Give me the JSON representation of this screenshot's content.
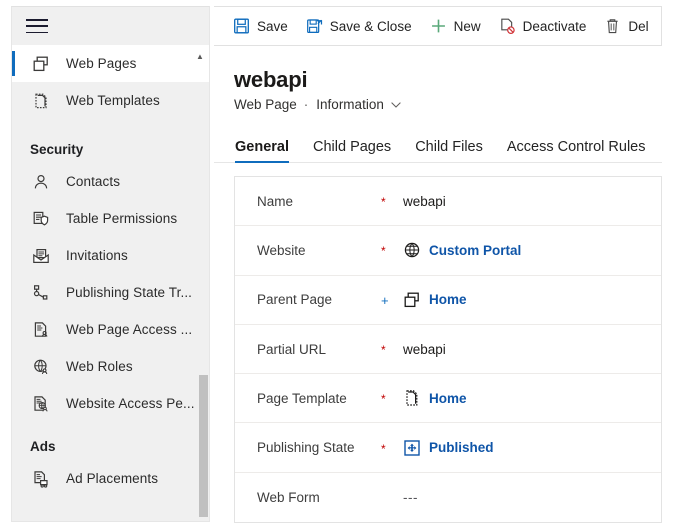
{
  "sidebar": {
    "menu_icon": "hamburger-icon",
    "scroll_up_icon": "scroll-up-arrow",
    "items": [
      {
        "type": "item",
        "label": "Web Pages",
        "icon": "web-pages-icon",
        "selected": true
      },
      {
        "type": "item",
        "label": "Web Templates",
        "icon": "web-templates-icon",
        "selected": false
      },
      {
        "type": "group",
        "label": "Security"
      },
      {
        "type": "item",
        "label": "Contacts",
        "icon": "contact-person-icon",
        "selected": false
      },
      {
        "type": "item",
        "label": "Table  Permissions",
        "icon": "table-permissions-icon",
        "selected": false
      },
      {
        "type": "item",
        "label": "Invitations",
        "icon": "invitations-envelope-icon",
        "selected": false
      },
      {
        "type": "item",
        "label": "Publishing State Tr...",
        "icon": "publishing-state-transition-icon",
        "selected": false
      },
      {
        "type": "item",
        "label": "Web Page Access ...",
        "icon": "web-page-access-icon",
        "selected": false
      },
      {
        "type": "item",
        "label": "Web Roles",
        "icon": "web-roles-globe-icon",
        "selected": false
      },
      {
        "type": "item",
        "label": "Website Access Pe...",
        "icon": "website-access-icon",
        "selected": false
      },
      {
        "type": "group",
        "label": "Ads"
      },
      {
        "type": "item",
        "label": "Ad Placements",
        "icon": "ad-placements-icon",
        "selected": false
      }
    ]
  },
  "commandbar": {
    "commands": [
      {
        "label": "Save",
        "icon": "save-icon"
      },
      {
        "label": "Save & Close",
        "icon": "save-and-close-icon"
      },
      {
        "label": "New",
        "icon": "plus-icon"
      },
      {
        "label": "Deactivate",
        "icon": "deactivate-icon"
      },
      {
        "label": "Del",
        "icon": "delete-trash-icon"
      }
    ]
  },
  "header": {
    "title": "webapi",
    "entity": "Web Page",
    "separator": "·",
    "form_name": "Information",
    "chevron": "⌄"
  },
  "tabs": [
    {
      "label": "General",
      "active": true
    },
    {
      "label": "Child Pages",
      "active": false
    },
    {
      "label": "Child Files",
      "active": false
    },
    {
      "label": "Access Control Rules",
      "active": false
    }
  ],
  "form": {
    "fields": [
      {
        "label": "Name",
        "required": "*",
        "required_kind": "required",
        "value": "webapi",
        "icon": null,
        "is_link": false
      },
      {
        "label": "Website",
        "required": "*",
        "required_kind": "required",
        "value": "Custom Portal",
        "icon": "globe-icon",
        "is_link": true
      },
      {
        "label": "Parent Page",
        "required": "+",
        "required_kind": "optional",
        "value": "Home",
        "icon": "web-pages-icon",
        "is_link": true
      },
      {
        "label": "Partial URL",
        "required": "*",
        "required_kind": "required",
        "value": "webapi",
        "icon": null,
        "is_link": false
      },
      {
        "label": "Page Template",
        "required": "*",
        "required_kind": "required",
        "value": "Home",
        "icon": "page-template-icon",
        "is_link": true
      },
      {
        "label": "Publishing State",
        "required": "*",
        "required_kind": "required",
        "value": "Published",
        "icon": "publishing-state-icon",
        "is_link": true
      },
      {
        "label": "Web Form",
        "required": "",
        "required_kind": "none",
        "value": "---",
        "icon": null,
        "is_link": false
      }
    ]
  },
  "colors": {
    "accent": "#0f6cbd",
    "link": "#0f55a8",
    "required_marker": "#c00000",
    "optional_marker": "#0f6cbd",
    "sidebar_bg": "#f0f0f0",
    "new_icon_green": "#5aa97a",
    "deactivate_red": "#d13438"
  }
}
